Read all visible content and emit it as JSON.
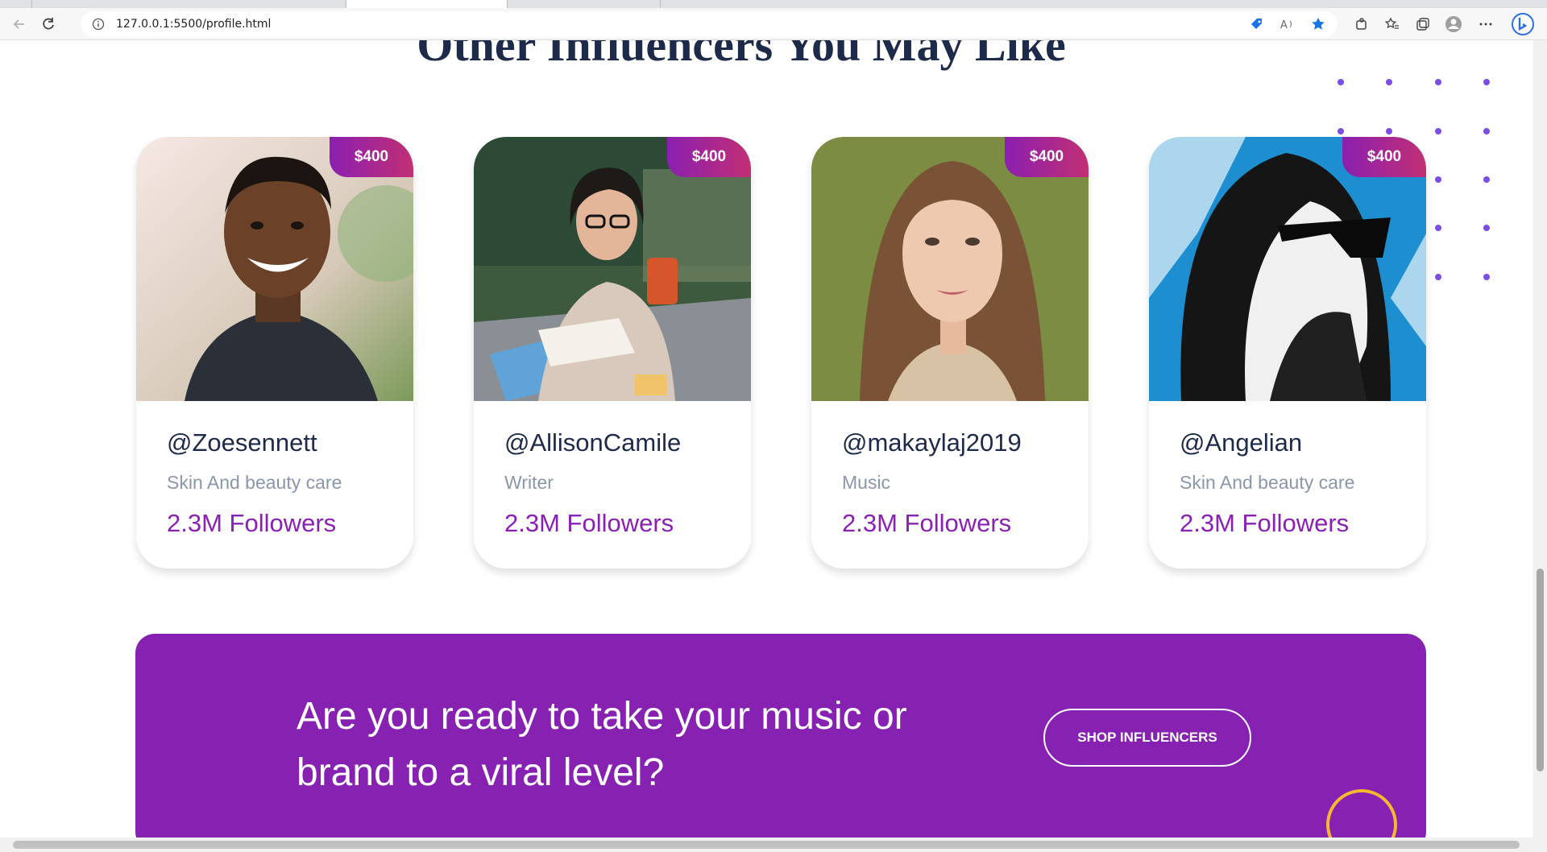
{
  "browser": {
    "url": "127.0.0.1:5500/profile.html"
  },
  "section": {
    "title": "Other Influencers You May Like"
  },
  "cards": [
    {
      "price": "$400",
      "handle": "@Zoesennett",
      "category": "Skin And beauty care",
      "followers": "2.3M Followers"
    },
    {
      "price": "$400",
      "handle": "@AllisonCamile",
      "category": "Writer",
      "followers": "2.3M Followers"
    },
    {
      "price": "$400",
      "handle": "@makaylaj2019",
      "category": "Music",
      "followers": "2.3M Followers"
    },
    {
      "price": "$400",
      "handle": "@Angelian",
      "category": "Skin And beauty care",
      "followers": "2.3M Followers"
    }
  ],
  "cta": {
    "headline": "Are you ready to take your music or brand to a viral level?",
    "button_label": "SHOP INFLUENCERS"
  },
  "colors": {
    "primary_purple": "#8621b2",
    "title_navy": "#1e2a4a",
    "accent_ring": "#f7b731",
    "dot_color": "#7a4de6"
  }
}
